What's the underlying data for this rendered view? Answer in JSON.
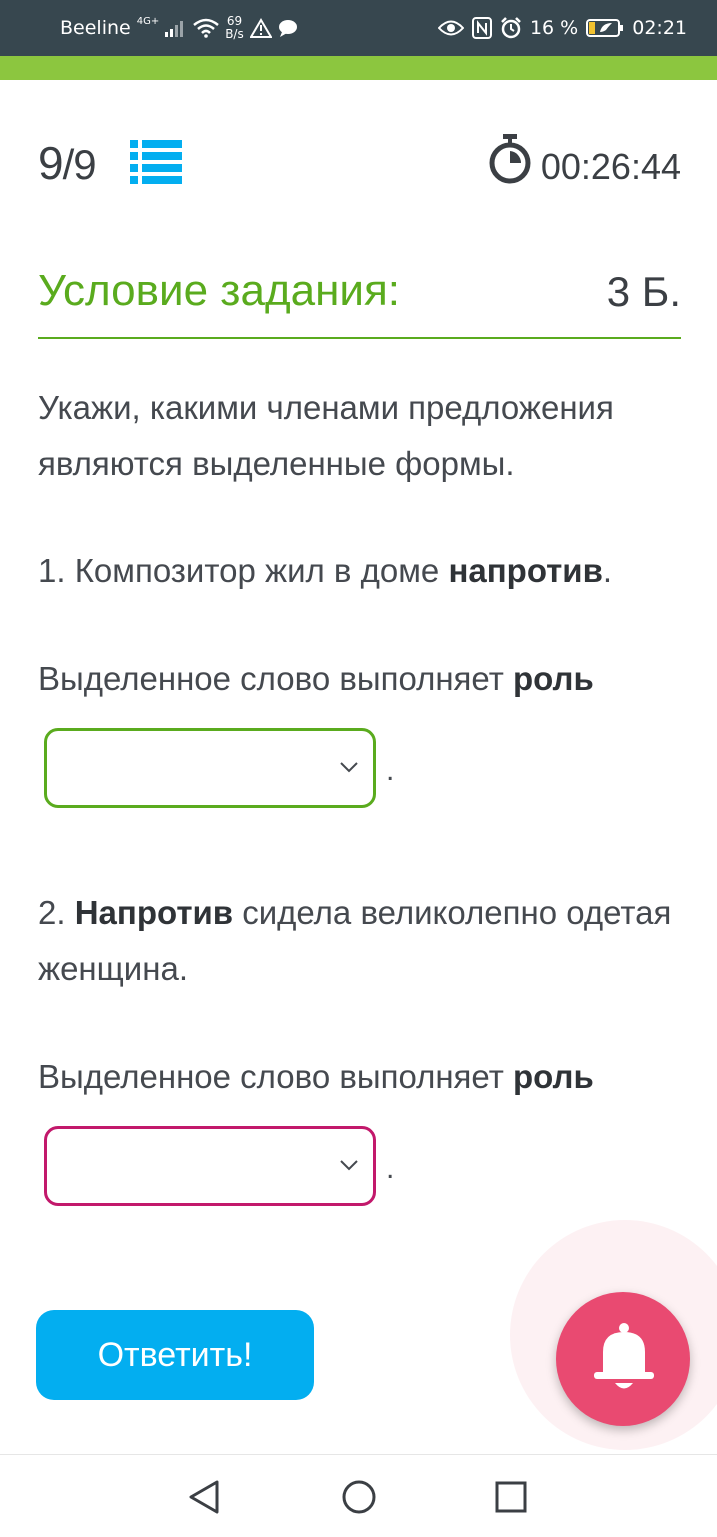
{
  "status_bar": {
    "carrier": "Beeline",
    "network": "4G+",
    "speed_value": "69",
    "speed_unit": "B/s",
    "battery": "16 %",
    "time": "02:21"
  },
  "header": {
    "question_current": "9",
    "question_total": "/9",
    "timer": "00:26:44"
  },
  "task": {
    "title": "Условие задания:",
    "points": "3 Б.",
    "instruction": "Укажи, какими членами предложения являются выделенные формы.",
    "q1_prefix": "1. Композитор жил в доме ",
    "q1_bold": "напротив",
    "q1_suffix": ".",
    "role_text": "Выделенное слово выполняет ",
    "role_bold": "роль",
    "select1_value": "",
    "select2_value": "",
    "dot": ".",
    "q2_prefix": "2. ",
    "q2_bold": "Напротив",
    "q2_suffix": " сидела великолепно одетая женщина."
  },
  "actions": {
    "answer_label": "Ответить!"
  },
  "colors": {
    "accent_green": "#5aab1e",
    "top_bar_green": "#8cc63f",
    "button_blue": "#03aef0",
    "select2_border": "#c2186b",
    "bell_pink": "#e94a71"
  },
  "icons": {
    "list": "list-icon",
    "timer": "stopwatch-icon",
    "bell": "bell-icon"
  }
}
